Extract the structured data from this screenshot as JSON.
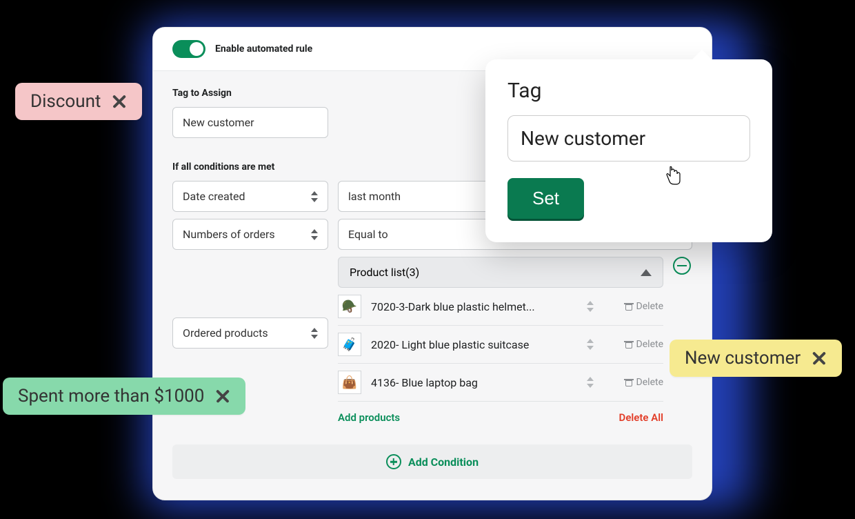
{
  "colors": {
    "accent": "#0a8e5a",
    "danger": "#e23d28"
  },
  "header": {
    "toggle_label": "Enable automated rule",
    "toggle_on": true
  },
  "tag_section": {
    "label": "Tag to Assign",
    "value": "New customer"
  },
  "conditions_section": {
    "label": "If all conditions are met"
  },
  "rules": [
    {
      "field": "Date created",
      "value": "last month"
    },
    {
      "field": "Numbers of orders",
      "value": "Equal to"
    }
  ],
  "product_rule": {
    "field": "Ordered products",
    "accordion_label": "Product list(3)",
    "items": [
      {
        "thumb": "🪖",
        "name": "7020-3-Dark blue plastic helmet..."
      },
      {
        "thumb": "🧳",
        "name": "2020- Light blue plastic suitcase"
      },
      {
        "thumb": "👜",
        "name": "4136- Blue laptop bag"
      }
    ],
    "delete_label": "Delete",
    "add_products_label": "Add products",
    "delete_all_label": "Delete All"
  },
  "add_condition_label": "Add Condition",
  "chips": {
    "pink": "Discount",
    "green": "Spent more than $1000",
    "yellow": "New customer"
  },
  "popover": {
    "title": "Tag",
    "value": "New customer",
    "button": "Set"
  }
}
